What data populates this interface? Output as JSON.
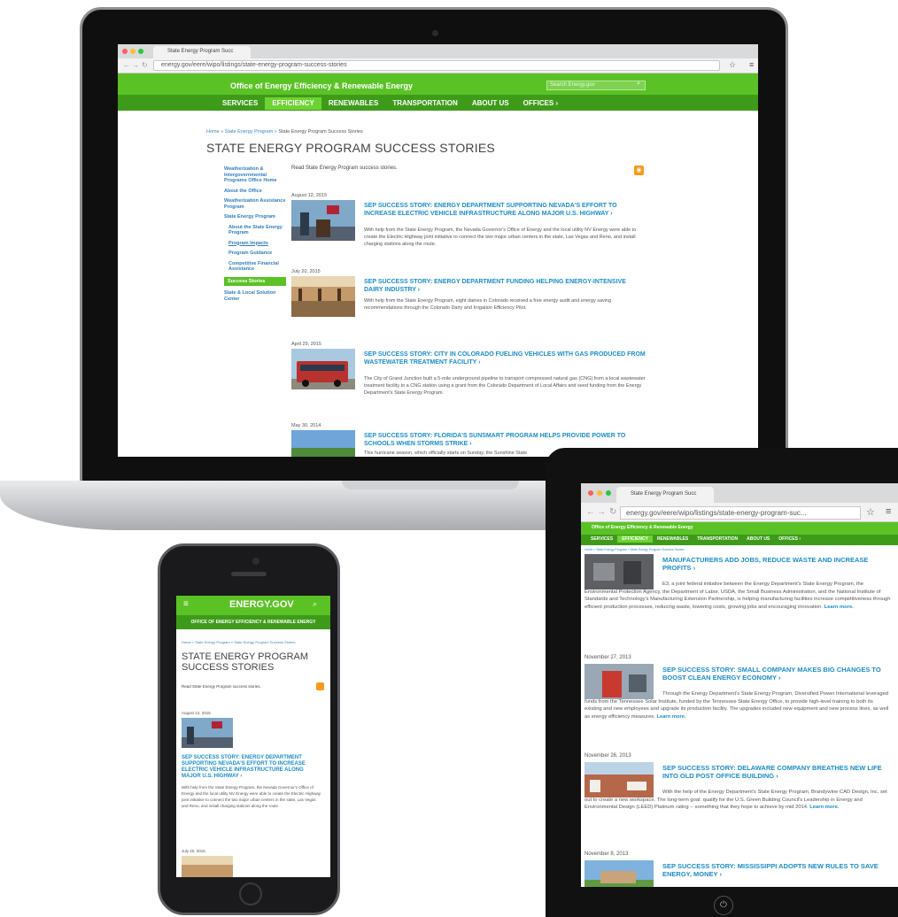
{
  "laptop": {
    "tab_title": "State Energy Program Succ",
    "url": "energy.gov/eere/wipo/listings/state-energy-program-success-stories",
    "site_title": "Office of Energy Efficiency & Renewable Energy",
    "search_placeholder": "Search Energy.gov",
    "nav": [
      "SERVICES",
      "EFFICIENCY",
      "RENEWABLES",
      "TRANSPORTATION",
      "ABOUT US",
      "OFFICES ›"
    ],
    "breadcrumb": {
      "home": "Home",
      "sep": " » ",
      "program": "State Energy Program",
      "current": "State Energy Program Success Stories"
    },
    "page_title": "STATE ENERGY PROGRAM SUCCESS STORIES",
    "sidebar": [
      "Weatherization & Intergovernmental Programs Office Home",
      "About the Office",
      "Weatherization Assistance Program",
      "State Energy Program",
      "About the State Energy Program",
      "Program Impacts",
      "Program Guidance",
      "Competitive Financial Assistance",
      "Success Stories",
      "State & Local Solution Center"
    ],
    "intro": "Read State Energy Program success stories.",
    "stories": [
      {
        "date": "August 12, 2015",
        "title": "SEP SUCCESS STORY: ENERGY DEPARTMENT SUPPORTING NEVADA'S EFFORT TO INCREASE ELECTRIC VEHICLE INFRASTRUCTURE ALONG MAJOR U.S. HIGHWAY ›",
        "body": "With help from the State Energy Program, the Nevada Governor's Office of Energy and the local utility NV Energy were able to create the Electric Highway joint initiative to connect the two major urban centers in the state, Las Vegas and Reno, and install charging stations along the route."
      },
      {
        "date": "July 20, 2015",
        "title": "SEP SUCCESS STORY: ENERGY DEPARTMENT FUNDING HELPING ENERGY-INTENSIVE DAIRY INDUSTRY ›",
        "body": "With help from the State Energy Program, eight dairies in Colorado received a free energy audit and energy saving recommendations through the Colorado Dairy and Irrigation Efficiency Pilot."
      },
      {
        "date": "April 29, 2015",
        "title": "SEP SUCCESS STORY: CITY IN COLORADO FUELING VEHICLES WITH GAS PRODUCED FROM WASTEWATER TREATMENT FACILITY ›",
        "body": "The City of Grand Junction built a 5-mile underground pipeline to transport compressed natural gas (CNG) from a local wastewater treatment facility to a CNG station using a grant from the Colorado Department of Local Affairs and seed funding from the Energy Department's State Energy Program."
      },
      {
        "date": "May 30, 2014",
        "title": "SEP SUCCESS STORY: FLORIDA'S SUNSMART PROGRAM HELPS PROVIDE POWER TO SCHOOLS WHEN STORMS STRIKE ›",
        "body": "This hurricane season, which officially starts on Sunday, the Sunshine State"
      }
    ]
  },
  "phone": {
    "logo": "ENERGY.GOV",
    "subheader": "OFFICE OF ENERGY EFFICIENCY & RENEWABLE ENERGY",
    "breadcrumb": "Home » State Energy Program » State Energy Program Success Stories",
    "page_title": "STATE ENERGY PROGRAM SUCCESS STORIES",
    "intro": "Read State Energy Program success stories.",
    "date1": "August 12, 2015",
    "story_title": "SEP SUCCESS STORY: ENERGY DEPARTMENT SUPPORTING NEVADA'S EFFORT TO INCREASE ELECTRIC VEHICLE INFRASTRUCTURE ALONG MAJOR U.S. HIGHWAY ›",
    "story_body": "With help from the State Energy Program, the Nevada Governor's Office of Energy and the local utility NV Energy were able to create the Electric Highway joint initiative to connect the two major urban centers in the state, Las Vegas and Reno, and install charging stations along the route.",
    "date2": "July 20, 2015"
  },
  "tablet": {
    "tab_title": "State Energy Program Succ",
    "url": "energy.gov/eere/wipo/listings/state-energy-program-suc...",
    "site_title": "Office of Energy Efficiency & Renewable Energy",
    "nav": [
      "SERVICES",
      "EFFICIENCY",
      "RENEWABLES",
      "TRANSPORTATION",
      "ABOUT US",
      "OFFICES ›"
    ],
    "breadcrumb": "Home » State Energy Program » State Energy Program Success Stories",
    "stories": [
      {
        "date": "",
        "title": "MANUFACTURERS ADD JOBS, REDUCE WASTE AND INCREASE PROFITS ›",
        "body": "E3, a joint federal initiative between the Energy Department's State Energy Program, the Environmental Protection Agency, the Department of Labor, USDA, the Small Business Administration, and the National Institute of Standards and Technology's Manufacturing Extension Partnership, is helping manufacturing facilities increase competitiveness through efficient production processes, reducing waste, lowering costs, growing jobs and encouraging innovation.",
        "more": "Learn more."
      },
      {
        "date": "November 27, 2013",
        "title": "SEP SUCCESS STORY: SMALL COMPANY MAKES BIG CHANGES TO BOOST CLEAN ENERGY ECONOMY ›",
        "body": "Through the Energy Department's State Energy Program, Diversified Power International leveraged funds from the Tennessee Solar Institute, funded by the Tennessee State Energy Office, to provide high-level training to both its existing and new employees and upgrade its production facility. The upgrades included new equipment and new process lines, as well as energy efficiency measures.",
        "more": "Learn more."
      },
      {
        "date": "November 26, 2013",
        "title": "SEP SUCCESS STORY: DELAWARE COMPANY BREATHES NEW LIFE INTO OLD POST OFFICE BUILDING ›",
        "body": "With the help of the Energy Department's State Energy Program, Brandywine CAD Design, Inc. set out to create a new workspace. The long-term goal: qualify for the U.S. Green Building Council's Leadership in Energy and Environmental Design (LEED) Platinum rating -- something that they hope to achieve by mid 2014.",
        "more": "Learn more."
      },
      {
        "date": "November 8, 2013",
        "title": "SEP SUCCESS STORY: MISSISSIPPI ADOPTS NEW RULES TO SAVE ENERGY, MONEY ›",
        "body": "",
        "more": ""
      }
    ]
  },
  "colors": {
    "green": "#5bc226",
    "dark_green": "#3e9b1a",
    "link_blue": "#1b8dc8",
    "rss_orange": "#f89b1b"
  }
}
